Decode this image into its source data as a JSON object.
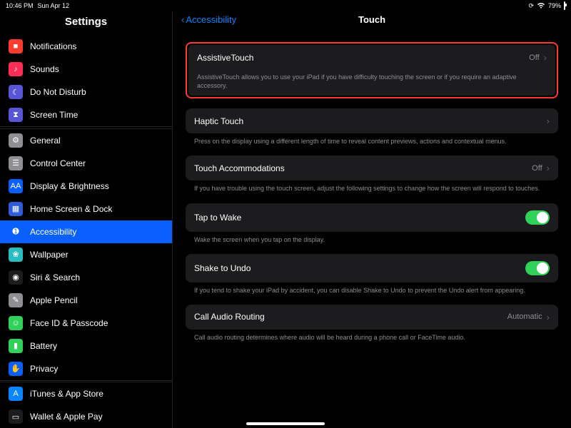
{
  "statusbar": {
    "time": "10:46 PM",
    "date": "Sun Apr 12",
    "battery_pct": "79%"
  },
  "sidebar": {
    "title": "Settings",
    "items": [
      {
        "label": "Notifications",
        "icon_bg": "#ff3b30",
        "glyph": "■"
      },
      {
        "label": "Sounds",
        "icon_bg": "#ff2d55",
        "glyph": "♪"
      },
      {
        "label": "Do Not Disturb",
        "icon_bg": "#5856d6",
        "glyph": "☾"
      },
      {
        "label": "Screen Time",
        "icon_bg": "#5856d6",
        "glyph": "⧗"
      }
    ],
    "items2": [
      {
        "label": "General",
        "icon_bg": "#8e8e93",
        "glyph": "⚙"
      },
      {
        "label": "Control Center",
        "icon_bg": "#8e8e93",
        "glyph": "☰"
      },
      {
        "label": "Display & Brightness",
        "icon_bg": "#0a60ff",
        "glyph": "AA"
      },
      {
        "label": "Home Screen & Dock",
        "icon_bg": "#2e5bd6",
        "glyph": "▦"
      },
      {
        "label": "Accessibility",
        "icon_bg": "#0a60ff",
        "glyph": "➊",
        "selected": true
      },
      {
        "label": "Wallpaper",
        "icon_bg": "#29bdc1",
        "glyph": "❀"
      },
      {
        "label": "Siri & Search",
        "icon_bg": "#1c1c1e",
        "glyph": "◉"
      },
      {
        "label": "Apple Pencil",
        "icon_bg": "#8e8e93",
        "glyph": "✎"
      },
      {
        "label": "Face ID & Passcode",
        "icon_bg": "#30d158",
        "glyph": "☺"
      },
      {
        "label": "Battery",
        "icon_bg": "#30d158",
        "glyph": "▮"
      },
      {
        "label": "Privacy",
        "icon_bg": "#0a60ff",
        "glyph": "✋"
      }
    ],
    "items3": [
      {
        "label": "iTunes & App Store",
        "icon_bg": "#0a84ff",
        "glyph": "A"
      },
      {
        "label": "Wallet & Apple Pay",
        "icon_bg": "#1c1c1e",
        "glyph": "▭"
      }
    ]
  },
  "detail": {
    "back_label": "Accessibility",
    "title": "Touch",
    "sections": [
      {
        "label": "AssistiveTouch",
        "value": "Off",
        "disclosure": true,
        "footer": "AssistiveTouch allows you to use your iPad if you have difficulty touching the screen or if you require an adaptive accessory.",
        "highlighted": true
      },
      {
        "label": "Haptic Touch",
        "value": "",
        "disclosure": true,
        "footer": "Press on the display using a different length of time to reveal content previews, actions and contextual menus."
      },
      {
        "label": "Touch Accommodations",
        "value": "Off",
        "disclosure": true,
        "footer": "If you have trouble using the touch screen, adjust the following settings to change how the screen will respond to touches."
      },
      {
        "label": "Tap to Wake",
        "toggle": true,
        "on": true,
        "footer": "Wake the screen when you tap on the display."
      },
      {
        "label": "Shake to Undo",
        "toggle": true,
        "on": true,
        "footer": "If you tend to shake your iPad by accident, you can disable Shake to Undo to prevent the Undo alert from appearing."
      },
      {
        "label": "Call Audio Routing",
        "value": "Automatic",
        "disclosure": true,
        "footer": "Call audio routing determines where audio will be heard during a phone call or FaceTime audio."
      }
    ]
  }
}
